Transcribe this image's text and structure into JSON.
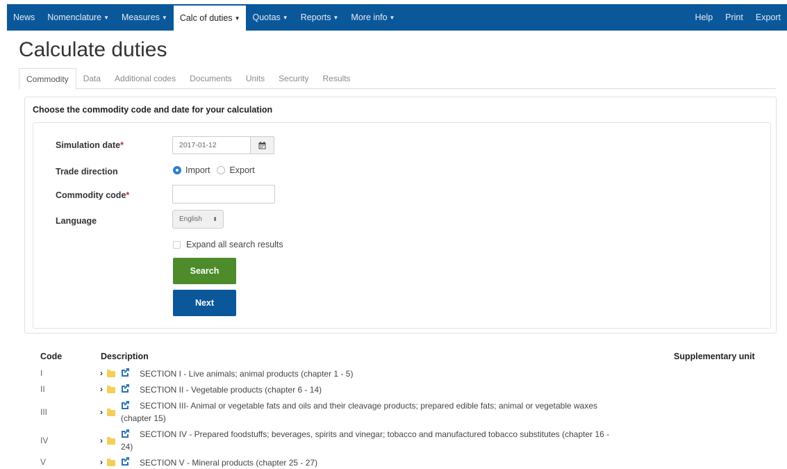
{
  "nav": {
    "left": [
      {
        "label": "News",
        "caret": false
      },
      {
        "label": "Nomenclature",
        "caret": true
      },
      {
        "label": "Measures",
        "caret": true
      },
      {
        "label": "Calc of duties",
        "caret": true,
        "active": true
      },
      {
        "label": "Quotas",
        "caret": true
      },
      {
        "label": "Reports",
        "caret": true
      },
      {
        "label": "More info",
        "caret": true
      }
    ],
    "right": [
      "Help",
      "Print",
      "Export"
    ]
  },
  "page_title": "Calculate duties",
  "tabs": [
    "Commodity",
    "Data",
    "Additional codes",
    "Documents",
    "Units",
    "Security",
    "Results"
  ],
  "form": {
    "heading": "Choose the commodity code and date for your calculation",
    "simulation_date_label": "Simulation date",
    "simulation_date_value": "2017-01-12",
    "trade_direction_label": "Trade direction",
    "import_label": "Import",
    "export_label": "Export",
    "commodity_code_label": "Commodity code",
    "commodity_code_value": "",
    "language_label": "Language",
    "language_value": "English",
    "expand_label": "Expand all search results",
    "search_label": "Search",
    "next_label": "Next",
    "required_mark": "*"
  },
  "table": {
    "headers": {
      "code": "Code",
      "description": "Description",
      "supp_unit": "Supplementary unit"
    },
    "rows": [
      {
        "code": "I",
        "line1": "SECTION I - Live animals; animal products (chapter 1 - 5)",
        "line2": ""
      },
      {
        "code": "II",
        "line1": "SECTION II - Vegetable products (chapter 6 - 14)",
        "line2": ""
      },
      {
        "code": "III",
        "line1": "SECTION III- Animal or vegetable fats and oils and their cleavage products; prepared edible fats; animal or vegetable waxes",
        "line2": "(chapter 15)"
      },
      {
        "code": "IV",
        "line1": "SECTION IV - Prepared foodstuffs; beverages, spirits and vinegar; tobacco and manufactured tobacco substitutes (chapter 16 -",
        "line2": "24)"
      },
      {
        "code": "V",
        "line1": "SECTION V - Mineral products (chapter 25 - 27)",
        "line2": ""
      }
    ]
  }
}
